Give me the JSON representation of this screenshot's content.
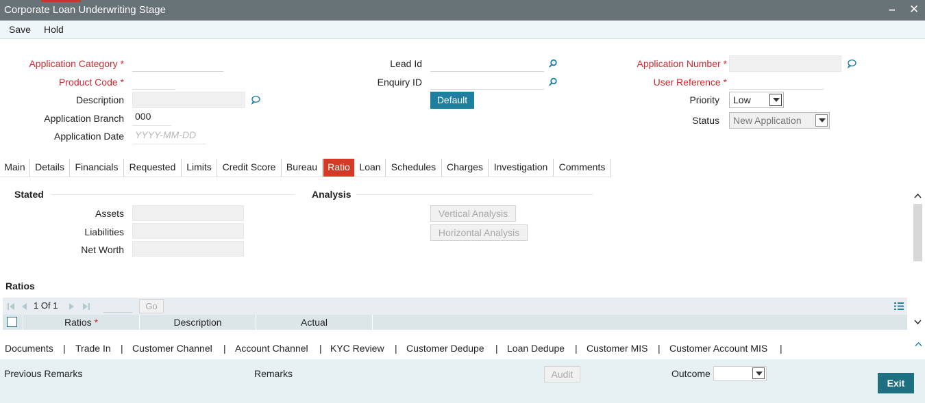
{
  "window": {
    "title": "Corporate Loan Underwriting Stage",
    "minimize": "–",
    "close": "✕"
  },
  "menu": {
    "save": "Save",
    "hold": "Hold"
  },
  "header": {
    "application_category_label": "Application Category",
    "product_code_label": "Product Code",
    "description_label": "Description",
    "application_branch_label": "Application Branch",
    "application_branch_value": "000",
    "application_date_label": "Application Date",
    "application_date_placeholder": "YYYY-MM-DD",
    "lead_id_label": "Lead Id",
    "enquiry_id_label": "Enquiry ID",
    "default_button": "Default",
    "application_number_label": "Application Number",
    "user_reference_label": "User Reference",
    "priority_label": "Priority",
    "priority_value": "Low",
    "status_label": "Status",
    "status_value": "New Application",
    "required_marker": "*"
  },
  "tabs": [
    "Main",
    "Details",
    "Financials",
    "Requested",
    "Limits",
    "Credit Score",
    "Bureau",
    "Ratio",
    "Loan",
    "Schedules",
    "Charges",
    "Investigation",
    "Comments"
  ],
  "active_tab": "Ratio",
  "stated": {
    "title": "Stated",
    "assets_label": "Assets",
    "liabilities_label": "Liabilities",
    "net_worth_label": "Net Worth"
  },
  "analysis": {
    "title": "Analysis",
    "vertical_button": "Vertical Analysis",
    "horizontal_button": "Horizontal Analysis"
  },
  "ratios": {
    "title": "Ratios",
    "pager_text": "1 Of 1",
    "go_button": "Go",
    "columns": [
      "Ratios",
      "Description",
      "Actual"
    ]
  },
  "links": [
    "Documents",
    "|",
    "Trade In",
    "|",
    "Customer Channel",
    "|",
    "Account Channel",
    "|",
    "KYC Review",
    "|",
    "Customer Dedupe",
    "|",
    "Loan Dedupe",
    "|",
    "Customer MIS",
    "|",
    "Customer Account MIS",
    "|"
  ],
  "footer": {
    "previous_remarks_label": "Previous Remarks",
    "remarks_label": "Remarks",
    "audit_button": "Audit",
    "outcome_label": "Outcome",
    "exit_button": "Exit"
  },
  "colors": {
    "title_bar": "#687378",
    "active_tab": "#d43b26",
    "required_label": "#d0272e",
    "primary_button": "#1f7fa1",
    "exit_button": "#1e6f82"
  }
}
